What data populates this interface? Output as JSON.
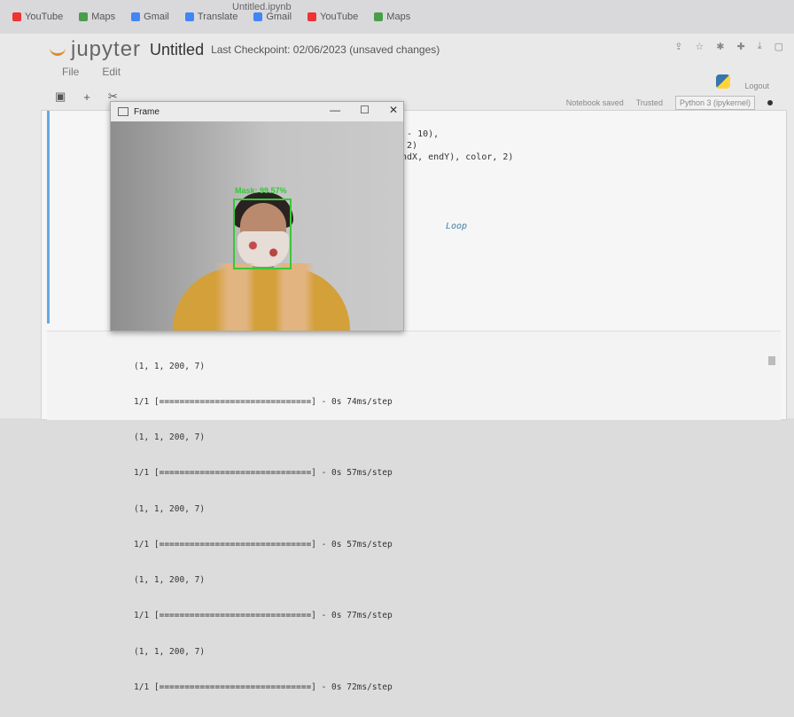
{
  "browser": {
    "tab_title": "Untitled.ipynb",
    "bookmarks": [
      {
        "label": "YouTube",
        "color": "#e33"
      },
      {
        "label": "Maps",
        "color": "#4a9d4a"
      },
      {
        "label": "Gmail",
        "color": "#4285f4"
      },
      {
        "label": "Translate",
        "color": "#4285f4"
      },
      {
        "label": "Gmail",
        "color": "#4285f4"
      },
      {
        "label": "YouTube",
        "color": "#e33"
      },
      {
        "label": "Maps",
        "color": "#4a9d4a"
      }
    ]
  },
  "jupyter": {
    "logo": "jupyter",
    "title": "Untitled",
    "checkpoint": "Last Checkpoint: 02/06/2023  (unsaved changes)",
    "menu": [
      "File",
      "Edit"
    ],
    "logout": "Logout",
    "notebook_saved": "Notebook saved",
    "trusted": "Trusted",
    "kernel": "Python 3 (ipykernel)"
  },
  "code_lines": [
    "Y - 10),",
    ", 2)",
    "endX, endY), color, 2)",
    "",
    "",
    "",
    "",
    "",
    ""
  ],
  "code_comment": "Loop",
  "output_lines": [
    "(1, 1, 200, 7)",
    "1/1 [==============================] - 0s 74ms/step",
    "(1, 1, 200, 7)",
    "1/1 [==============================] - 0s 57ms/step",
    "(1, 1, 200, 7)",
    "1/1 [==============================] - 0s 57ms/step",
    "(1, 1, 200, 7)",
    "1/1 [==============================] - 0s 77ms/step",
    "(1, 1, 200, 7)",
    "1/1 [==============================] - 0s 72ms/step"
  ],
  "frame": {
    "title": "Frame",
    "minimize": "—",
    "maximize": "☐",
    "close": "✕",
    "mask_label": "Mask: 99.57%",
    "box_color": "#37c837"
  }
}
